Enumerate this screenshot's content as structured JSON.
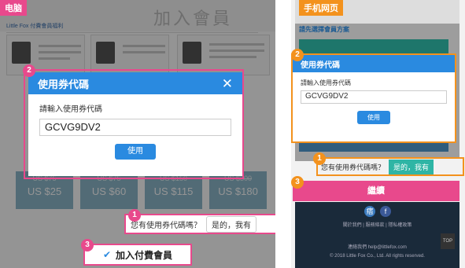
{
  "pc": {
    "tag": "电脑",
    "header_title": "加入會員",
    "lf_bar": "Little Fox 付費會員福利",
    "prices": [
      {
        "old": "US $75",
        "new": "US $25"
      },
      {
        "old": "US $75",
        "new": "US $60"
      },
      {
        "old": "US $150",
        "new": "US $115"
      },
      {
        "old": "US $300",
        "new": "US $180"
      }
    ],
    "modal": {
      "title": "使用券代碼",
      "close": "✕",
      "label": "請輸入使用券代碼",
      "input_value": "GCVG9DV2",
      "button": "使用"
    },
    "question": {
      "text": "您有使用券代碼嗎？",
      "yes": "是的，我有"
    },
    "join_button": "加入付費會員",
    "join_check": "✔",
    "badges": [
      "1",
      "2",
      "3"
    ]
  },
  "mobile": {
    "tag": "手机网页",
    "plan_title": "請先選擇會員方案",
    "modal": {
      "title": "使用券代碼",
      "label": "請輸入使用券代碼",
      "input_value": "GCVG9DV2",
      "button": "使用"
    },
    "question": {
      "text": "您有使用券代碼嗎？",
      "yes": "是的，我有"
    },
    "continue_button": "繼續",
    "footer_links": "關於我們 | 服務條款 | 隱私權政策",
    "footer_contact": "連絡我們 help@littlefox.com",
    "footer_copy": "© 2018 Little Fox Co., Ltd. All rights reserved.",
    "top_label": "TOP",
    "badges": [
      "1",
      "2",
      "3"
    ]
  },
  "colors": {
    "pink": "#e8498c",
    "blue": "#2a8ae0",
    "orange": "#f3921d",
    "teal": "#2fb5a5"
  }
}
